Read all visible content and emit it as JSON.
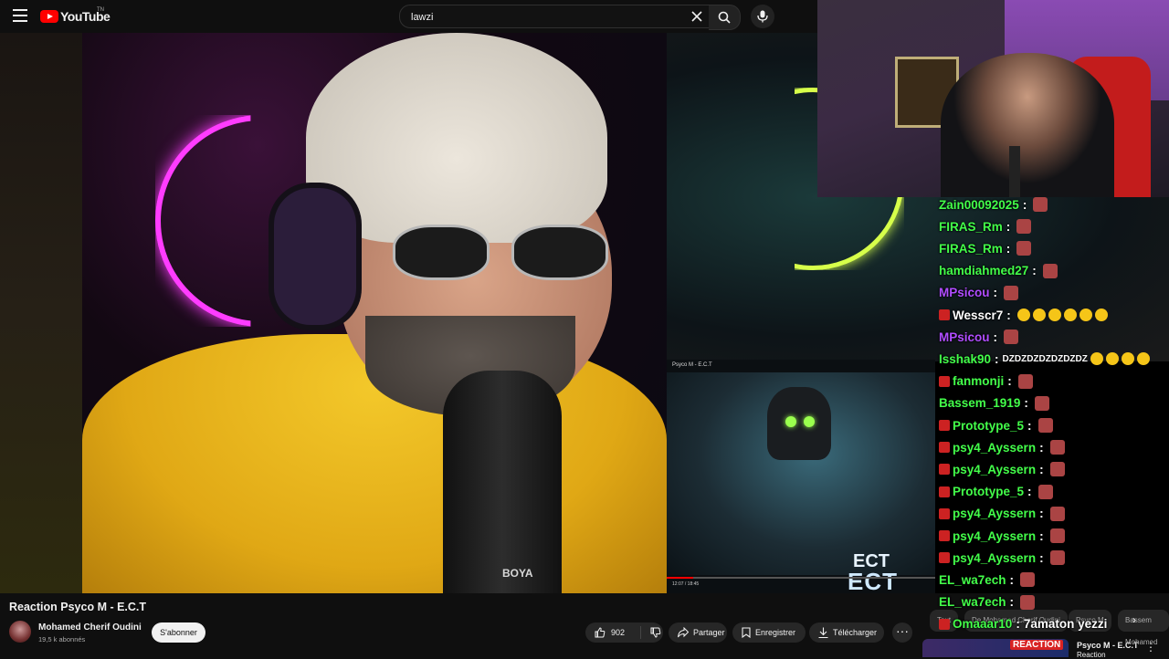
{
  "header": {
    "logo_text": "YouTube",
    "logo_sup": "TN",
    "search_value": "lawzi",
    "icons": [
      "menu-icon",
      "youtube-logo",
      "close-icon",
      "search-icon",
      "mic-icon"
    ]
  },
  "embed": {
    "title": "Psyco M - E.C.T",
    "ect_small": "ECT",
    "ect_big": "ECT",
    "time": "12:07 / 18:45",
    "progress_fraction": 0.1
  },
  "mic_brand": "BOYA",
  "chat": [
    {
      "user": "Zain00092025",
      "text": "",
      "color": "#43ff4a",
      "emote": true,
      "badge": false
    },
    {
      "user": "FIRAS_Rm",
      "text": "",
      "color": "#43ff4a",
      "emote": true,
      "badge": false
    },
    {
      "user": "FIRAS_Rm",
      "text": "",
      "color": "#43ff4a",
      "emote": true,
      "badge": false
    },
    {
      "user": "hamdiahmed27",
      "text": "",
      "color": "#43ff4a",
      "emote": true,
      "badge": false
    },
    {
      "user": "MPsicou",
      "text": "",
      "color": "#b04dff",
      "emote": true,
      "badge": false
    },
    {
      "user": "Wesscr7",
      "text": "",
      "color": "#ffffff",
      "emoji_count": 6,
      "badge": true
    },
    {
      "user": "MPsicou",
      "text": "",
      "color": "#b04dff",
      "emote": true,
      "badge": false
    },
    {
      "user": "Isshak90",
      "text": "DZDZDZDZDZDZDZ",
      "color": "#43ff4a",
      "emoji_count": 4,
      "badge": false
    },
    {
      "user": "fanmonji",
      "text": "",
      "color": "#43ff4a",
      "emote": true,
      "badge": true
    },
    {
      "user": "Bassem_1919",
      "text": "",
      "color": "#43ff4a",
      "emote": true,
      "badge": false
    },
    {
      "user": "Prototype_5",
      "text": "",
      "color": "#43ff4a",
      "emote": true,
      "badge": true
    },
    {
      "user": "psy4_Ayssern",
      "text": "",
      "color": "#43ff4a",
      "emote": true,
      "badge": true
    },
    {
      "user": "psy4_Ayssern",
      "text": "",
      "color": "#43ff4a",
      "emote": true,
      "badge": true
    },
    {
      "user": "Prototype_5",
      "text": "",
      "color": "#43ff4a",
      "emote": true,
      "badge": true
    },
    {
      "user": "psy4_Ayssern",
      "text": "",
      "color": "#43ff4a",
      "emote": true,
      "badge": true
    },
    {
      "user": "psy4_Ayssern",
      "text": "",
      "color": "#43ff4a",
      "emote": true,
      "badge": true
    },
    {
      "user": "psy4_Ayssern",
      "text": "",
      "color": "#43ff4a",
      "emote": true,
      "badge": true
    },
    {
      "user": "EL_wa7ech",
      "text": "",
      "color": "#43ff4a",
      "emote": true,
      "badge": false
    },
    {
      "user": "EL_wa7ech",
      "text": "",
      "color": "#43ff4a",
      "emote": true,
      "badge": false
    },
    {
      "user": "Omaaar10",
      "text": "7amaton yezzi",
      "color": "#43ff4a",
      "emote": false,
      "badge": true
    }
  ],
  "video": {
    "title": "Reaction Psyco M - E.C.T",
    "channel": "Mohamed Cherif Oudini",
    "subscribers": "19,5 k abonnés",
    "subscribe_label": "S'abonner",
    "likes": "902",
    "share_label": "Partager",
    "save_label": "Enregistrer",
    "download_label": "Télécharger",
    "more_label": "···"
  },
  "chips": [
    "Tout",
    "De Mohamed Cherif Oudini",
    "Psyco M",
    "Bassem Mohamed"
  ],
  "recommendation": {
    "badge": "REACTION",
    "title": "Psyco M - E.C.T",
    "subtitle": "Reaction"
  },
  "colors": {
    "bg": "#0f0f0f",
    "accent": "#ff0000",
    "chat_green": "#43ff4a",
    "chat_purple": "#b04dff"
  }
}
